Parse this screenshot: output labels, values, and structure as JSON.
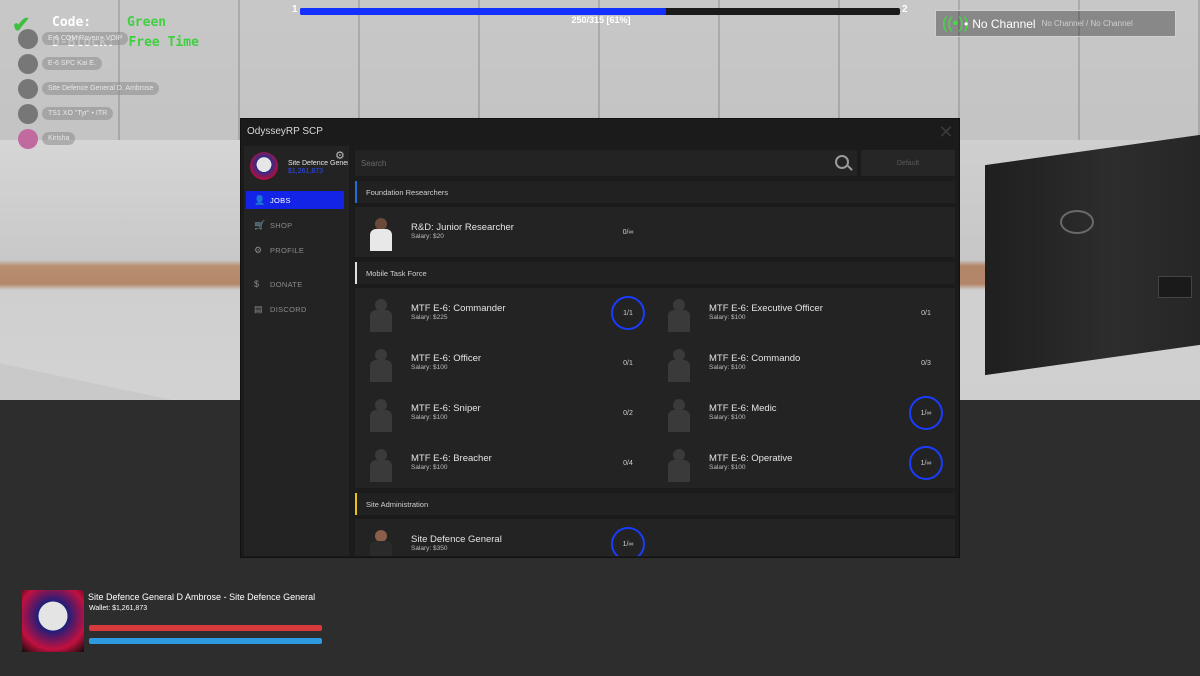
{
  "hud": {
    "code_label": "Code:",
    "code_value": "Green",
    "dblock_label": "D-Block:",
    "dblock_value": "Free Time",
    "xp_level_current": "1",
    "xp_level_next": "2",
    "xp_text": "250/315 [61%]",
    "xp_progress": 0.61,
    "radio_main": "No Channel",
    "radio_sub": "No Channel / No Channel"
  },
  "players": [
    {
      "text": "E-6 COM Raven • VOIP"
    },
    {
      "text": "E-6 SPC Kai E."
    },
    {
      "text": "Site Defence General D. Ambrose"
    },
    {
      "text": "TS1 XO \"Tyr\" • ITR"
    },
    {
      "text": "Kirisha"
    }
  ],
  "menu": {
    "title": "OdysseyRP SCP",
    "close_icon": "close-icon",
    "profile_name": "Site Defence General",
    "profile_money": "$1,261,873",
    "nav": [
      {
        "label": "JOBS",
        "icon": "person-icon",
        "active": true
      },
      {
        "label": "SHOP",
        "icon": "cart-icon"
      },
      {
        "label": "PROFILE",
        "icon": "gear-icon"
      },
      {
        "label": "DONATE",
        "icon": "donate-icon"
      },
      {
        "label": "DISCORD",
        "icon": "chat-icon"
      }
    ],
    "search_placeholder": "Search",
    "default_label": "Default",
    "categories": [
      {
        "name": "Foundation Researchers",
        "color": "#1f6fd6",
        "jobs": [
          {
            "name": "R&D: Junior Researcher",
            "salary": "Salary: $20",
            "slots": "0/∞",
            "ring": false
          }
        ]
      },
      {
        "name": "Mobile Task Force",
        "color": "#e0e0e0",
        "jobs": [
          {
            "name": "MTF E-6: Commander",
            "salary": "Salary: $225",
            "slots": "1/1",
            "ring": true
          },
          {
            "name": "MTF E-6: Executive Officer",
            "salary": "Salary: $100",
            "slots": "0/1",
            "ring": false
          },
          {
            "name": "MTF E-6: Officer",
            "salary": "Salary: $100",
            "slots": "0/1",
            "ring": false
          },
          {
            "name": "MTF E-6: Commando",
            "salary": "Salary: $100",
            "slots": "0/3",
            "ring": false
          },
          {
            "name": "MTF E-6: Sniper",
            "salary": "Salary: $100",
            "slots": "0/2",
            "ring": false
          },
          {
            "name": "MTF E-6: Medic",
            "salary": "Salary: $100",
            "slots": "1/∞",
            "ring": true
          },
          {
            "name": "MTF E-6: Breacher",
            "salary": "Salary: $100",
            "slots": "0/4",
            "ring": false
          },
          {
            "name": "MTF E-6: Operative",
            "salary": "Salary: $100",
            "slots": "1/∞",
            "ring": true
          }
        ]
      },
      {
        "name": "Site Administration",
        "color": "#e6c21a",
        "jobs": [
          {
            "name": "Site Defence General",
            "salary": "Salary: $350",
            "slots": "1/∞",
            "ring": true
          }
        ]
      }
    ]
  },
  "player_card": {
    "name": "Site Defence General D Ambrose - Site Defence General",
    "wallet": "Wallet: $1,261,873"
  },
  "colors": {
    "accent": "#1324e6",
    "health": "#d63a3a",
    "armor": "#2e9be0",
    "code_green": "#3fcf3f"
  }
}
